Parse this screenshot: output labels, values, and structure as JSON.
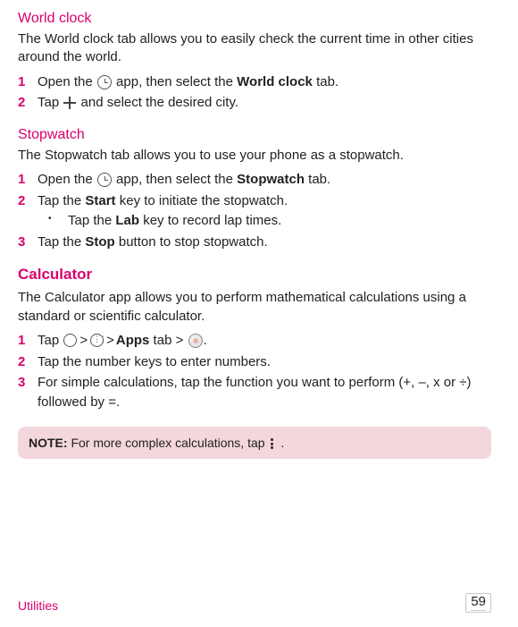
{
  "section1": {
    "title": "World clock",
    "intro": "The World clock tab allows you to easily check the current time in other cities around the world.",
    "steps": [
      {
        "num": "1",
        "prefix": "Open the ",
        "middle": " app, then select the ",
        "bold": "World clock",
        "suffix": " tab."
      },
      {
        "num": "2",
        "prefix": "Tap ",
        "suffix": " and select the desired city."
      }
    ]
  },
  "section2": {
    "title": "Stopwatch",
    "intro": "The Stopwatch tab allows you to use your phone as a stopwatch.",
    "steps": [
      {
        "num": "1",
        "prefix": "Open the ",
        "middle": " app, then select the ",
        "bold": "Stopwatch",
        "suffix": " tab."
      },
      {
        "num": "2",
        "prefix": "Tap the ",
        "bold": "Start",
        "suffix": " key to initiate the stopwatch.",
        "sub": [
          {
            "prefix": "Tap the ",
            "bold": "Lab",
            "suffix": " key to record lap times."
          }
        ]
      },
      {
        "num": "3",
        "prefix": "Tap the ",
        "bold": "Stop",
        "suffix": " button to stop stopwatch."
      }
    ]
  },
  "section3": {
    "title": "Calculator",
    "intro": "The Calculator app allows you to perform mathematical calculations using a standard or scientific calculator.",
    "steps": [
      {
        "num": "1",
        "prefix": "Tap ",
        "apps": "Apps",
        "tab": " tab > "
      },
      {
        "num": "2",
        "text": "Tap the number keys to enter numbers."
      },
      {
        "num": "3",
        "text": "For simple calculations, tap the function you want to perform (+, –, x or ÷) followed by =."
      }
    ]
  },
  "note": {
    "label": "NOTE:",
    "text": " For more complex calculations, tap ",
    "suffix": " ."
  },
  "footer": {
    "category": "Utilities",
    "page": "59"
  }
}
